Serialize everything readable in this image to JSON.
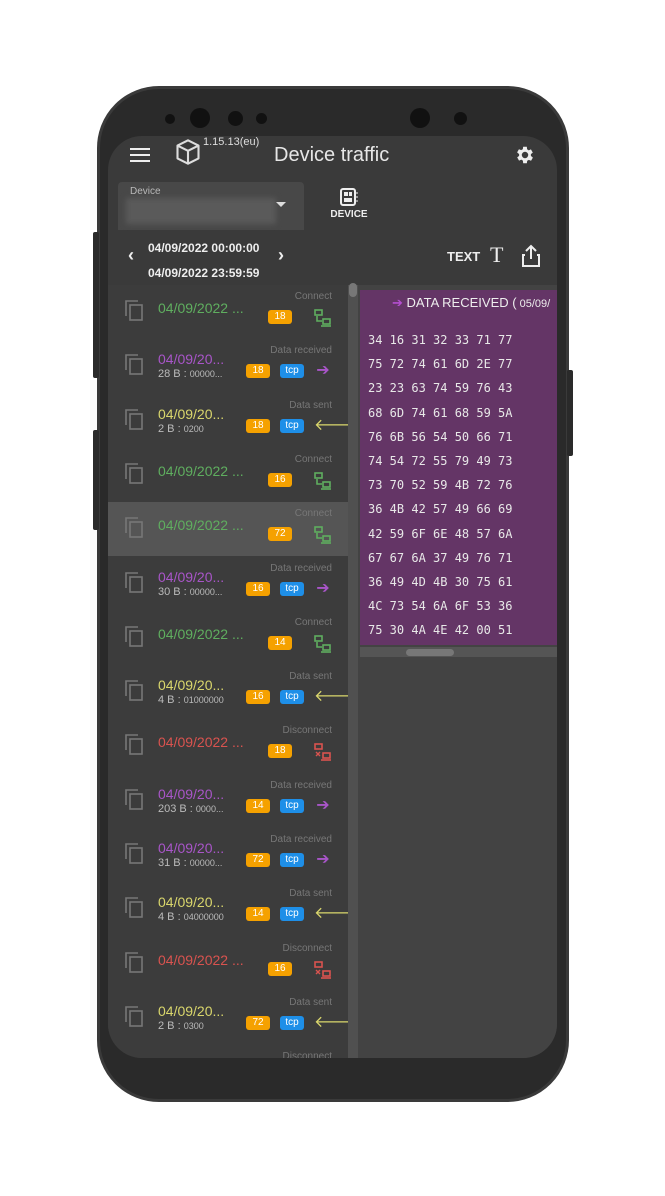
{
  "app": {
    "title": "Device traffic",
    "version": "1.15.13(eu)"
  },
  "device": {
    "label": "Device",
    "button": "DEVICE"
  },
  "range": {
    "from": "04/09/2022 00:00:00",
    "to": "04/09/2022 23:59:59"
  },
  "toolbar": {
    "text_label": "TEXT"
  },
  "colors": {
    "connect": "#5fae5f",
    "received": "#a855c8",
    "sent": "#d9d66c",
    "disconnect": "#d9534f",
    "port_badge": "#f5a100",
    "tcp_badge": "#1e8fe8",
    "hex_bg": "#643566"
  },
  "events": [
    {
      "type": "Connect",
      "kind": "connect",
      "date": "04/09/2022 ...",
      "port": "18"
    },
    {
      "type": "Data received",
      "kind": "received",
      "date": "04/09/20...",
      "size": "28 B : ",
      "data": "00000...",
      "port": "18",
      "proto": "tcp"
    },
    {
      "type": "Data sent",
      "kind": "sent",
      "date": "04/09/20...",
      "size": "2 B : ",
      "data": "0200",
      "port": "18",
      "proto": "tcp"
    },
    {
      "type": "Connect",
      "kind": "connect",
      "date": "04/09/2022 ...",
      "port": "16"
    },
    {
      "type": "Connect",
      "kind": "connect",
      "date": "04/09/2022 ...",
      "port": "72",
      "selected": true
    },
    {
      "type": "Data received",
      "kind": "received",
      "date": "04/09/20...",
      "size": "30 B : ",
      "data": "00000...",
      "port": "16",
      "proto": "tcp"
    },
    {
      "type": "Connect",
      "kind": "connect",
      "date": "04/09/2022 ...",
      "port": "14"
    },
    {
      "type": "Data sent",
      "kind": "sent",
      "date": "04/09/20...",
      "size": "4 B : ",
      "data": "01000000",
      "port": "16",
      "proto": "tcp"
    },
    {
      "type": "Disconnect",
      "kind": "disconnect",
      "date": "04/09/2022 ...",
      "port": "18"
    },
    {
      "type": "Data received",
      "kind": "received",
      "date": "04/09/20...",
      "size": "203 B : ",
      "data": "0000...",
      "port": "14",
      "proto": "tcp"
    },
    {
      "type": "Data received",
      "kind": "received",
      "date": "04/09/20...",
      "size": "31 B : ",
      "data": "00000...",
      "port": "72",
      "proto": "tcp"
    },
    {
      "type": "Data sent",
      "kind": "sent",
      "date": "04/09/20...",
      "size": "4 B : ",
      "data": "04000000",
      "port": "14",
      "proto": "tcp"
    },
    {
      "type": "Disconnect",
      "kind": "disconnect",
      "date": "04/09/2022 ...",
      "port": "16"
    },
    {
      "type": "Data sent",
      "kind": "sent",
      "date": "04/09/20...",
      "size": "2 B : ",
      "data": "0300",
      "port": "72",
      "proto": "tcp"
    },
    {
      "type": "Disconnect",
      "kind": "disconnect",
      "date": "",
      "port": ""
    }
  ],
  "detail": {
    "title": "DATA RECEIVED (",
    "date": " 05/09/",
    "hex": [
      "34 16 31 32 33 71 77",
      "75 72 74 61 6D 2E 77",
      "23 23 63 74 59 76 43",
      "68 6D 74 61 68 59 5A",
      "76 6B 56 54 50 66 71",
      "74 54 72 55 79 49 73",
      "73 70 52 59 4B 72 76",
      "36 4B 42 57 49 66 69",
      "42 59 6F 6E 48 57 6A",
      "67 67 6A 37 49 76 71",
      "36 49 4D 4B 30 75 61",
      "4C 73 54 6A 6F 53 36",
      "75 30 4A 4E 42 00 51"
    ]
  }
}
